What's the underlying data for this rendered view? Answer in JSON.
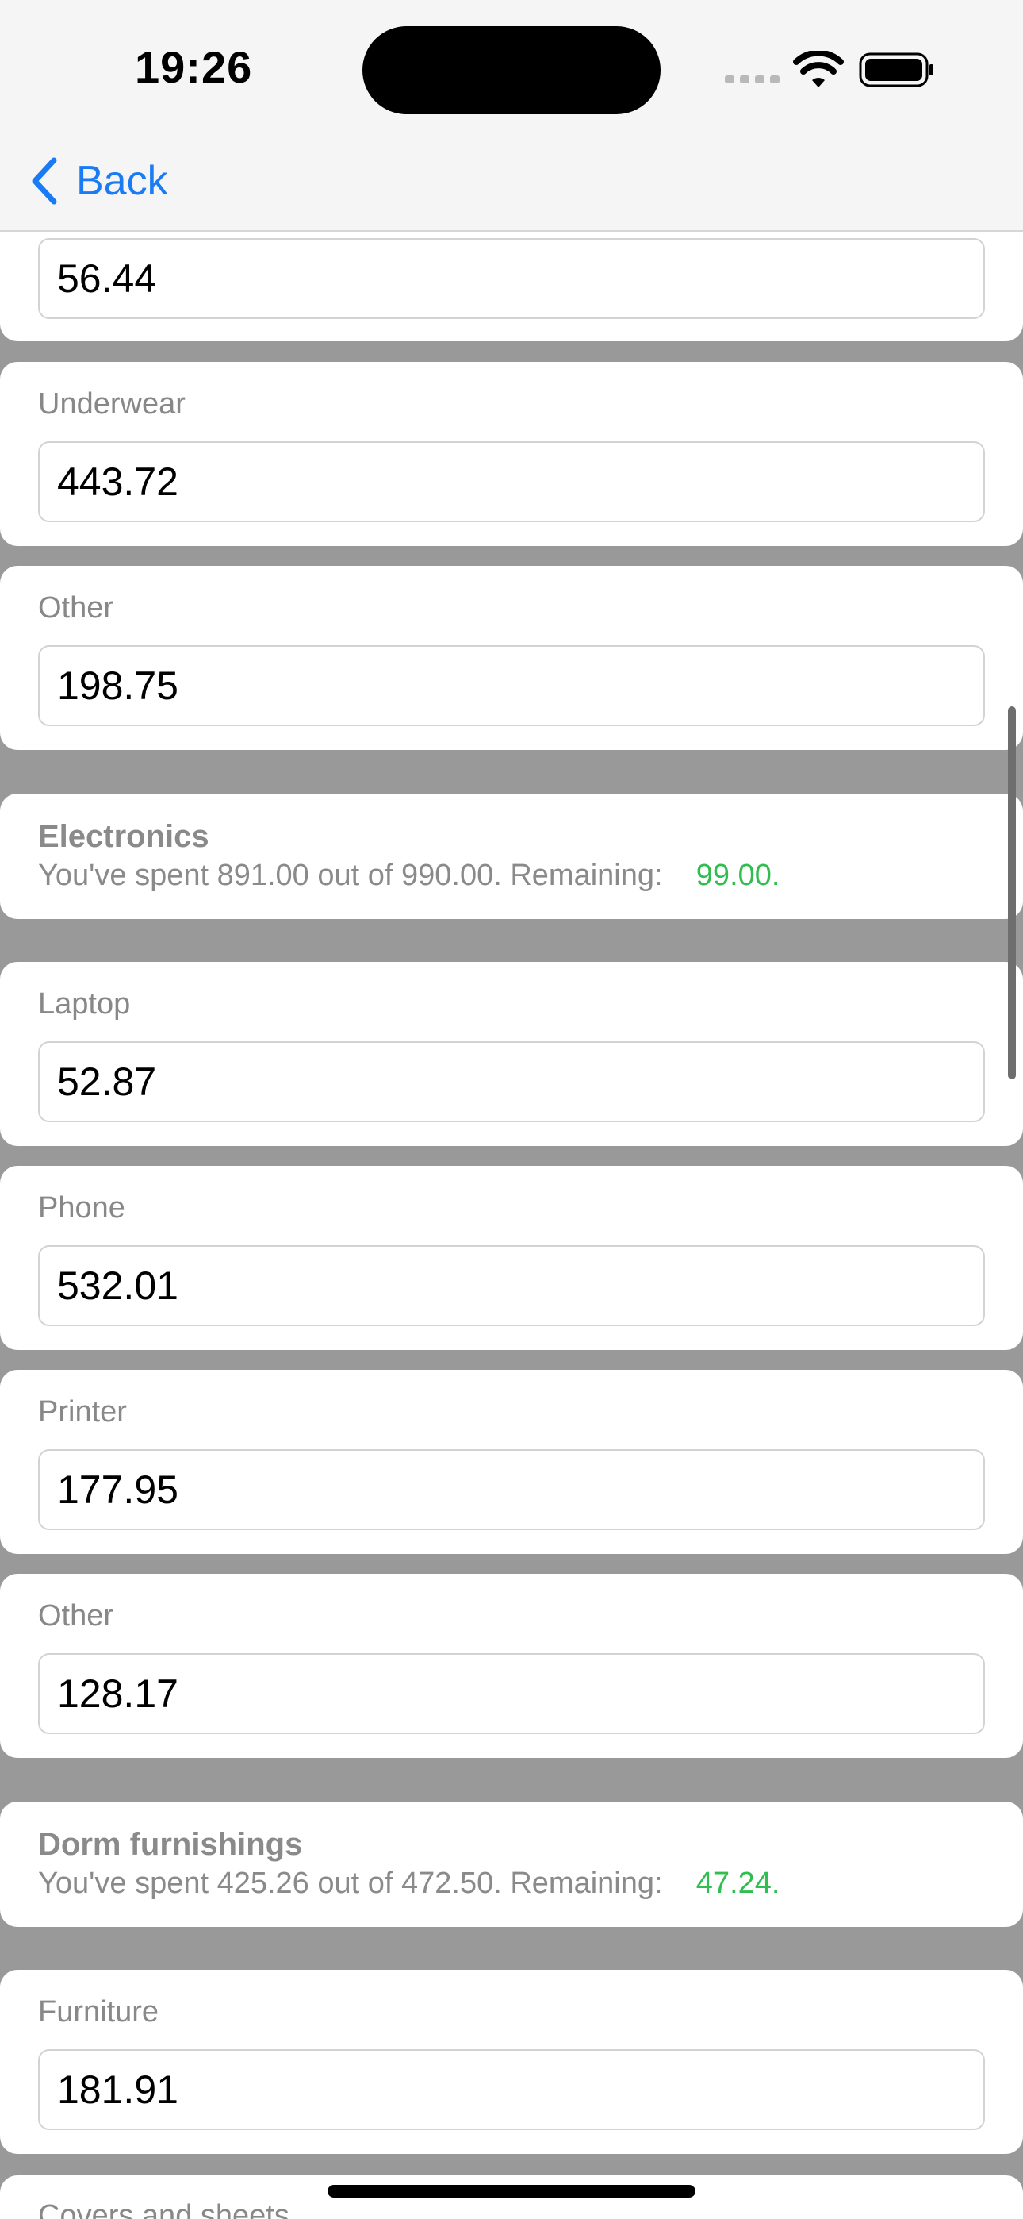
{
  "status_bar": {
    "time": "19:26"
  },
  "nav": {
    "back_label": "Back"
  },
  "clothing_partial": {
    "first_value": "56.44",
    "items": [
      {
        "label": "Underwear",
        "value": "443.72"
      },
      {
        "label": "Other",
        "value": "198.75"
      }
    ]
  },
  "electronics": {
    "title": "Electronics",
    "summary_text": "You've spent 891.00 out of 990.00. Remaining:",
    "remaining": "99.00.",
    "items": [
      {
        "label": "Laptop",
        "value": "52.87"
      },
      {
        "label": "Phone",
        "value": "532.01"
      },
      {
        "label": "Printer",
        "value": "177.95"
      },
      {
        "label": "Other",
        "value": "128.17"
      }
    ]
  },
  "dorm": {
    "title": "Dorm furnishings",
    "summary_text": "You've spent 425.26 out of 472.50. Remaining:",
    "remaining": "47.24.",
    "items": [
      {
        "label": "Furniture",
        "value": "181.91"
      },
      {
        "label": "Covers and sheets"
      }
    ]
  },
  "colors": {
    "accent": "#1a7cf5",
    "remaining_green": "#2fbe4f",
    "page_background": "#999999"
  }
}
